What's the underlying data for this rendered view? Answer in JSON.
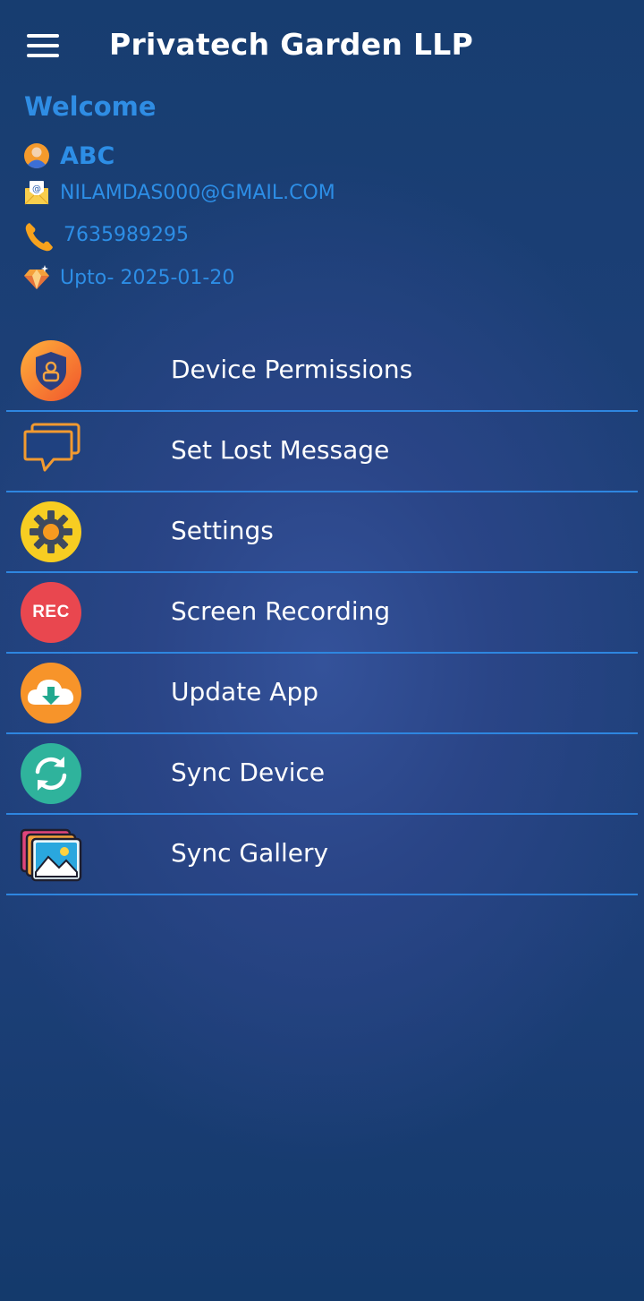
{
  "header": {
    "title": "Privatech Garden LLP"
  },
  "profile": {
    "welcome": "Welcome",
    "name": "ABC",
    "email": "NILAMDAS000@GMAIL.COM",
    "phone": "7635989295",
    "validity": "Upto- 2025-01-20",
    "icons": [
      "user-avatar-icon",
      "email-icon",
      "phone-icon",
      "diamond-icon"
    ]
  },
  "menu": [
    {
      "label": "Device Permissions",
      "icon": "shield-user-icon"
    },
    {
      "label": "Set Lost Message",
      "icon": "chat-bubbles-icon"
    },
    {
      "label": "Settings",
      "icon": "gear-icon"
    },
    {
      "label": "Screen Recording",
      "icon": "rec-icon",
      "icon_text": "REC"
    },
    {
      "label": "Update App",
      "icon": "cloud-download-icon"
    },
    {
      "label": "Sync Device",
      "icon": "sync-icon"
    },
    {
      "label": "Sync Gallery",
      "icon": "gallery-icon"
    }
  ],
  "colors": {
    "background": "#1d3f78",
    "accent_blue": "#2f8de4",
    "divider": "#2e86e0",
    "rec_red": "#e9474f",
    "orange": "#f7942a",
    "teal": "#2fb39c"
  }
}
